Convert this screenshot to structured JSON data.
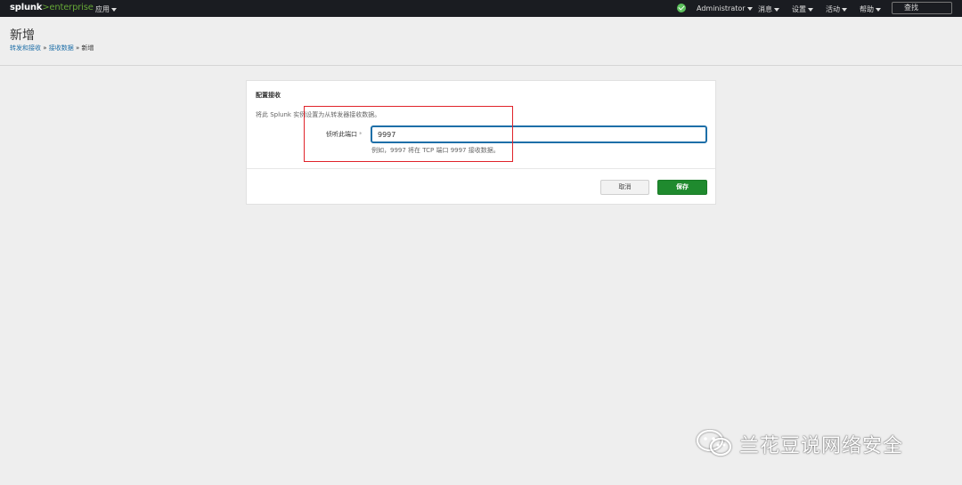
{
  "topbar": {
    "logo_main": "splunk",
    "logo_sep": ">",
    "logo_product": "enterprise",
    "apps_label": "应用",
    "user_label": "Administrator",
    "messages_label": "消息",
    "settings_label": "设置",
    "activity_label": "活动",
    "help_label": "帮助",
    "search_label": "查找",
    "health_color": "#5cc05c"
  },
  "page": {
    "title": "新增",
    "breadcrumb": [
      "转发和接收",
      "接收数据",
      "新增"
    ],
    "breadcrumb_sep": "»"
  },
  "form": {
    "section_title": "配置接收",
    "description": "将此 Splunk 实例设置为从转发器接收数据。",
    "port_label": "侦听此端口",
    "required_mark": "*",
    "port_value": "9997",
    "help_text": "例如，9997 将在 TCP 端口 9997 接收数据。",
    "cancel_label": "取消",
    "save_label": "保存"
  },
  "watermark": {
    "text": "兰花豆说网络安全",
    "icon": "wechat-icon"
  },
  "colors": {
    "accent": "#1e6fa8",
    "save_button": "#1f8a2e",
    "highlight": "#e0232a",
    "brand_green": "#65a637"
  }
}
